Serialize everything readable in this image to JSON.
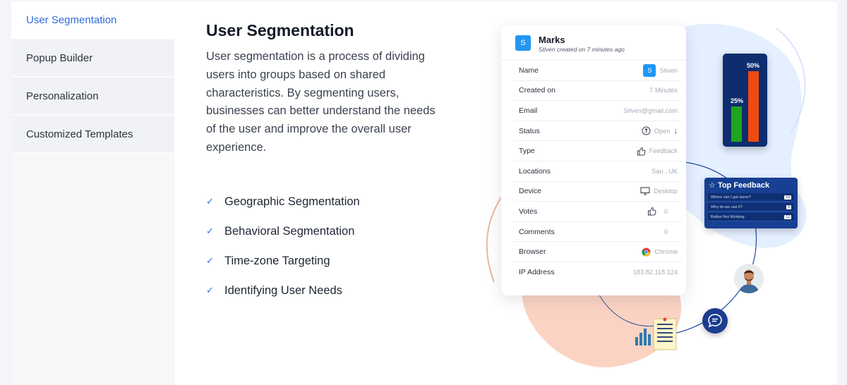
{
  "sidebar": {
    "items": [
      {
        "label": "User Segmentation",
        "active": true
      },
      {
        "label": "Popup Builder",
        "active": false
      },
      {
        "label": "Personalization",
        "active": false
      },
      {
        "label": "Customized Templates",
        "active": false
      }
    ]
  },
  "main": {
    "title": "User Segmentation",
    "description": "User segmentation is a process of dividing users into groups based on shared characteristics. By segmenting users, businesses can better understand the needs of the user and improve the overall user experience.",
    "features": [
      "Geographic Segmentation",
      "Behavioral Segmentation",
      "Time-zone Targeting",
      "Identifying User Needs"
    ],
    "check_icon": "check-icon"
  },
  "card": {
    "avatar_letter": "S",
    "name": "Marks",
    "subtitle": "Stiven created on 7 minutes ago",
    "rows": [
      {
        "key": "Name",
        "value": "Stiven",
        "icon": "avatar-s-icon"
      },
      {
        "key": "Created on",
        "value": "7 Minutes",
        "icon": ""
      },
      {
        "key": "Email",
        "value": "Stiven@gmail.com",
        "icon": ""
      },
      {
        "key": "Status",
        "value": "Open",
        "icon": "up-circle-icon"
      },
      {
        "key": "Type",
        "value": "Feedback",
        "icon": "thumbs-up-icon"
      },
      {
        "key": "Locations",
        "value": "San , UK",
        "icon": ""
      },
      {
        "key": "Device",
        "value": "Desktop",
        "icon": "monitor-icon"
      },
      {
        "key": "Votes",
        "value": "0",
        "icon": "thumbs-up-icon"
      },
      {
        "key": "Comments",
        "value": "0",
        "icon": ""
      },
      {
        "key": "Browser",
        "value": "Chrome",
        "icon": "chrome-icon"
      },
      {
        "key": "IP Address",
        "value": "183.82.118.124",
        "icon": ""
      }
    ]
  },
  "mini_chart": {
    "bars": [
      {
        "label": "25%",
        "value": 25,
        "color": "#1fa51f"
      },
      {
        "label": "50%",
        "value": 50,
        "color": "#f04a10"
      }
    ]
  },
  "feedback_tile": {
    "title": "Top Feedback",
    "items": [
      {
        "text": "Where can I get some?",
        "count": "14"
      },
      {
        "text": "Why do we use it?",
        "count": "8"
      },
      {
        "text": "Button Not Working",
        "count": "12"
      }
    ]
  },
  "colors": {
    "accent": "#2f6bdc",
    "dark_navy": "#0d2d6e",
    "blob_blue": "#e4efff",
    "blob_peach": "#fbd3c3"
  }
}
